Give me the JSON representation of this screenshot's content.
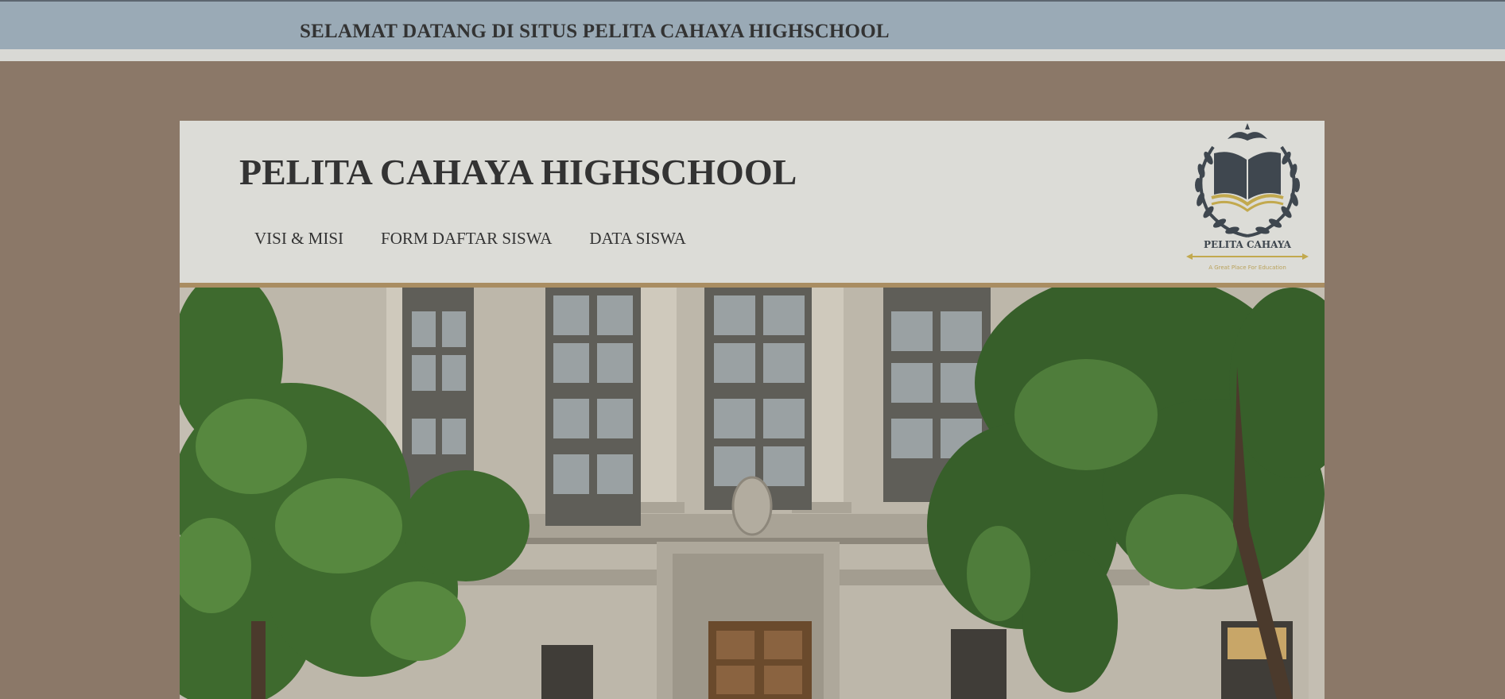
{
  "topbar": {
    "welcome_text": "SELAMAT DATANG DI SITUS PELITA CAHAYA HIGHSCHOOL"
  },
  "header": {
    "site_title": "PELITA CAHAYA HIGHSCHOOL",
    "nav": [
      {
        "label": "VISI & MISI"
      },
      {
        "label": "FORM DAFTAR SISWA"
      },
      {
        "label": "DATA SISWA"
      }
    ],
    "logo": {
      "name": "PELITA CAHAYA",
      "tagline": "A Great Place For Education",
      "icon": "book-laurel-emblem"
    }
  },
  "hero": {
    "image": "school-building-photo",
    "alt": "Neoclassical school building facade with trees"
  },
  "colors": {
    "page_bg": "#8b7868",
    "topbar_bg": "#9aaab6",
    "card_bg": "#dcdcd7",
    "divider": "#a98d62",
    "text": "#333333",
    "logo_gold": "#c2a94e",
    "logo_slate": "#3f474f"
  }
}
